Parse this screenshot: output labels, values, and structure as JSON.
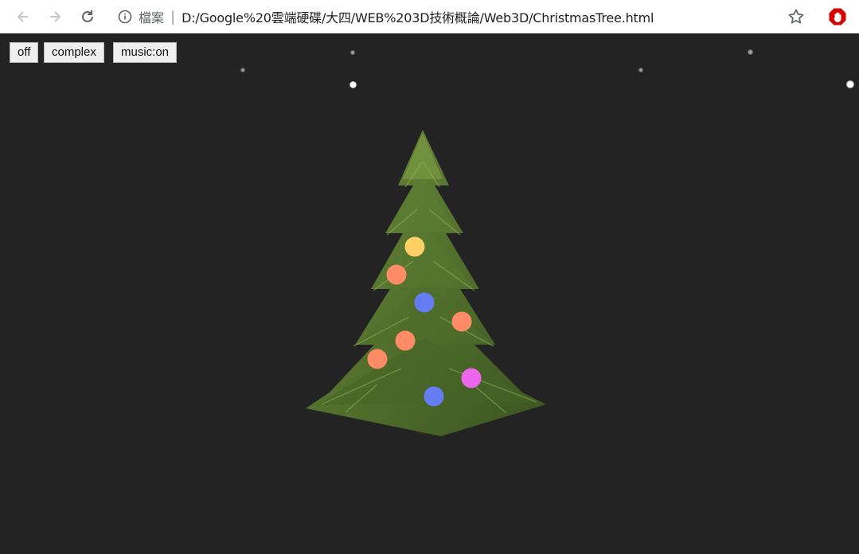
{
  "browser": {
    "scheme_label": "檔案",
    "separator": "|",
    "url": "D:/Google%20雲端硬碟/大四/WEB%203D技術概論/Web3D/ChristmasTree.html"
  },
  "controls": {
    "off_label": "off",
    "complex_label": "complex",
    "music_label": "music:on"
  },
  "colors": {
    "background": "#232323",
    "tree_green": "#4a6b2a",
    "ornament_yellow": "#ffd066",
    "ornament_orange": "#ff8c66",
    "ornament_blue": "#667cf2",
    "ornament_magenta": "#ee66ee",
    "extension_red": "#d50000"
  },
  "icons": [
    "back-arrow-icon",
    "forward-arrow-icon",
    "reload-icon",
    "info-icon",
    "bookmark-star-icon",
    "adblock-extension-icon"
  ]
}
